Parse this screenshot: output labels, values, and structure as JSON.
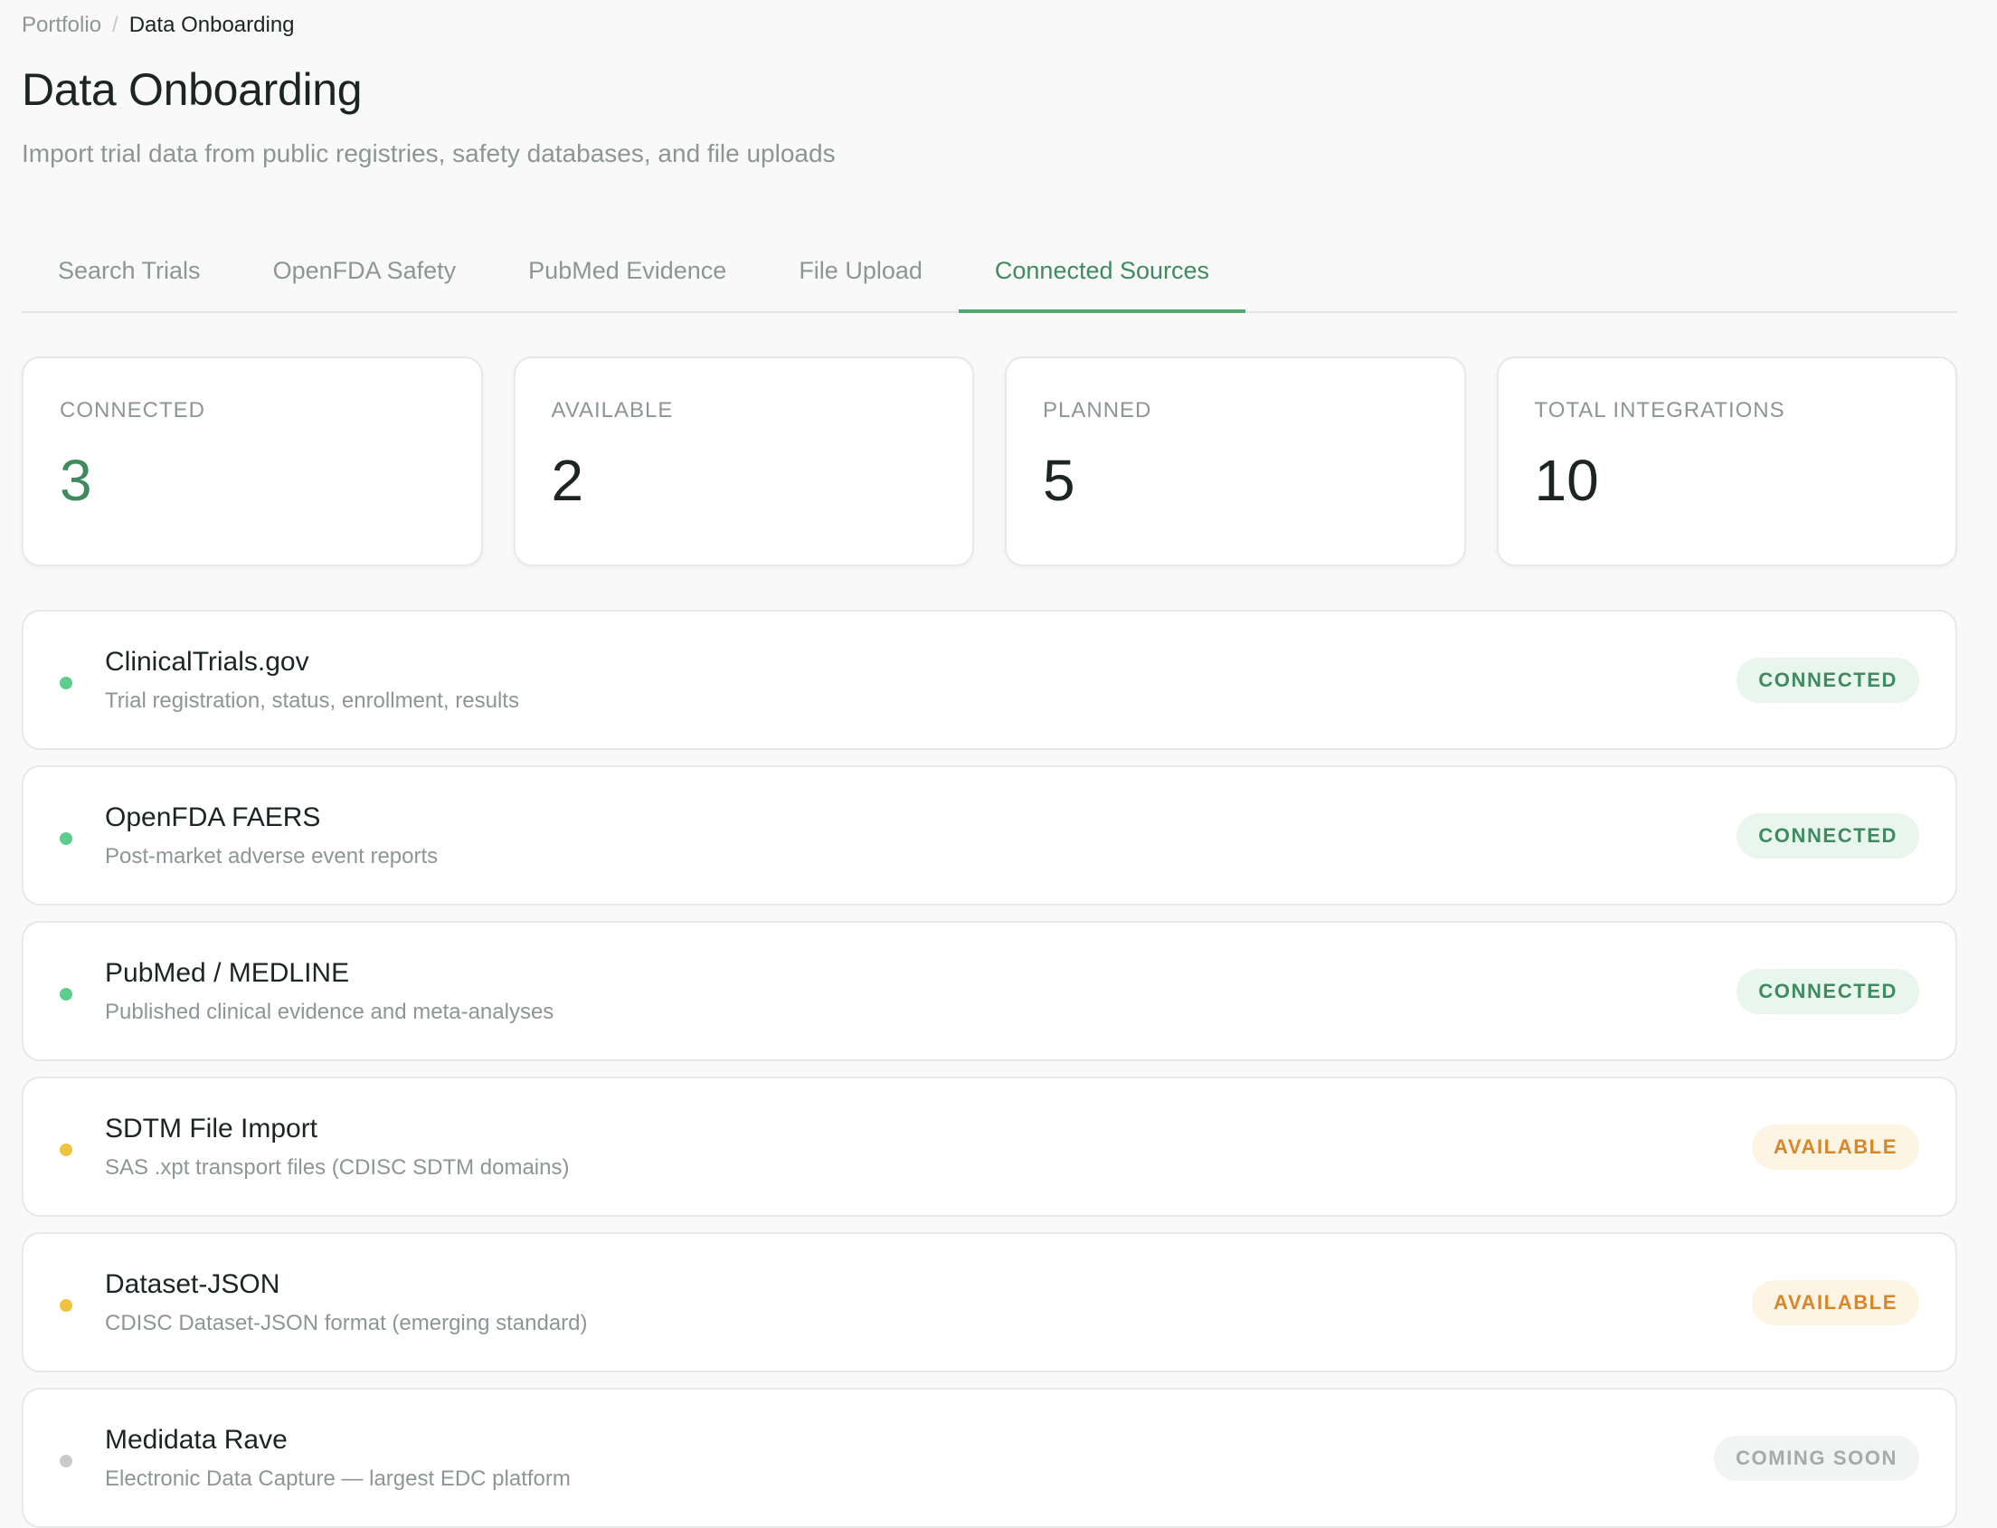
{
  "breadcrumb": {
    "parent": "Portfolio",
    "separator": "/",
    "current": "Data Onboarding"
  },
  "header": {
    "title": "Data Onboarding",
    "subtitle": "Import trial data from public registries, safety databases, and file uploads"
  },
  "tabs": [
    {
      "label": "Search Trials",
      "active": false
    },
    {
      "label": "OpenFDA Safety",
      "active": false
    },
    {
      "label": "PubMed Evidence",
      "active": false
    },
    {
      "label": "File Upload",
      "active": false
    },
    {
      "label": "Connected Sources",
      "active": true
    }
  ],
  "stats": [
    {
      "label": "CONNECTED",
      "value": "3",
      "accent": true
    },
    {
      "label": "AVAILABLE",
      "value": "2",
      "accent": false
    },
    {
      "label": "PLANNED",
      "value": "5",
      "accent": false
    },
    {
      "label": "TOTAL INTEGRATIONS",
      "value": "10",
      "accent": false
    }
  ],
  "sources": [
    {
      "name": "ClinicalTrials.gov",
      "description": "Trial registration, status, enrollment, results",
      "status": "CONNECTED",
      "status_type": "connected"
    },
    {
      "name": "OpenFDA FAERS",
      "description": "Post-market adverse event reports",
      "status": "CONNECTED",
      "status_type": "connected"
    },
    {
      "name": "PubMed / MEDLINE",
      "description": "Published clinical evidence and meta-analyses",
      "status": "CONNECTED",
      "status_type": "connected"
    },
    {
      "name": "SDTM File Import",
      "description": "SAS .xpt transport files (CDISC SDTM domains)",
      "status": "AVAILABLE",
      "status_type": "available"
    },
    {
      "name": "Dataset-JSON",
      "description": "CDISC Dataset-JSON format (emerging standard)",
      "status": "AVAILABLE",
      "status_type": "available"
    },
    {
      "name": "Medidata Rave",
      "description": "Electronic Data Capture — largest EDC platform",
      "status": "COMING SOON",
      "status_type": "planned"
    }
  ],
  "colors": {
    "connected": {
      "dot": "#5ccd8c",
      "badge_bg": "#e9f6ee",
      "badge_text": "#3f8a5f"
    },
    "available": {
      "dot": "#efc23f",
      "badge_bg": "#fdf4e4",
      "badge_text": "#d8862a"
    },
    "planned": {
      "dot": "#c9cccb",
      "badge_bg": "#f2f3f3",
      "badge_text": "#a6abaa"
    }
  }
}
